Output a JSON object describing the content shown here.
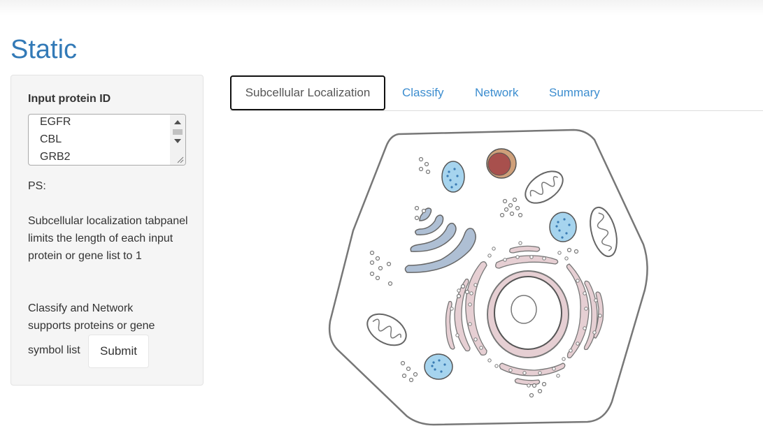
{
  "page": {
    "title": "Static"
  },
  "sidebar": {
    "input_label": "Input protein ID",
    "proteins": [
      "EGFR",
      "CBL",
      "GRB2"
    ],
    "ps": "PS:",
    "note1": "Subcellular localization tabpanel limits the length of each input protein or gene list to 1",
    "note2": "Classify and Network supports proteins or gene",
    "note3": "symbol list",
    "submit_label": "Submit"
  },
  "tabs": [
    {
      "label": "Subcellular Localization",
      "active": true
    },
    {
      "label": "Classify",
      "active": false
    },
    {
      "label": "Network",
      "active": false
    },
    {
      "label": "Summary",
      "active": false
    }
  ],
  "colors": {
    "title": "#337ab7",
    "tab_link": "#3c8dcf",
    "vesicle_fill": "#a6d4ee",
    "vesicle_dot": "#3a7bb3",
    "er_fill": "#e6cfd3",
    "golgi_fill": "#aebfd4",
    "nucleolus_fill": "#a8504d"
  },
  "image": {
    "name": "animal-cell-diagram"
  }
}
